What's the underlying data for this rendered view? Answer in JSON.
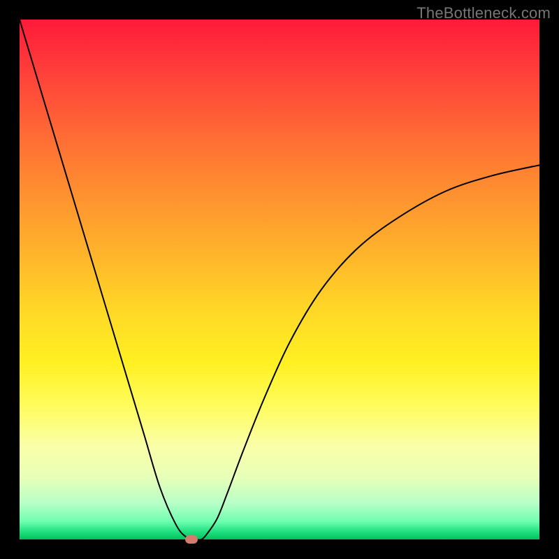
{
  "watermark": "TheBottleneck.com",
  "chart_data": {
    "type": "line",
    "title": "",
    "xlabel": "",
    "ylabel": "",
    "xlim": [
      0,
      100
    ],
    "ylim": [
      0,
      100
    ],
    "series": [
      {
        "name": "bottleneck_curve",
        "x": [
          0,
          3,
          6,
          9,
          12,
          15,
          18,
          21,
          24,
          27,
          30,
          32,
          34,
          35,
          36,
          38,
          40,
          43,
          47,
          52,
          58,
          65,
          73,
          82,
          91,
          100
        ],
        "values": [
          100,
          90,
          80,
          70,
          60,
          50,
          40,
          30,
          20,
          10,
          3,
          0.5,
          0,
          0,
          1,
          4,
          9,
          17,
          27,
          38,
          48,
          56,
          62,
          67,
          70,
          72
        ]
      }
    ],
    "marker": {
      "x": 33,
      "y": 0
    },
    "gradient_stops": [
      {
        "pos": 0,
        "color": "#ff1a3a"
      },
      {
        "pos": 50,
        "color": "#ffd826"
      },
      {
        "pos": 100,
        "color": "#00c060"
      }
    ]
  }
}
